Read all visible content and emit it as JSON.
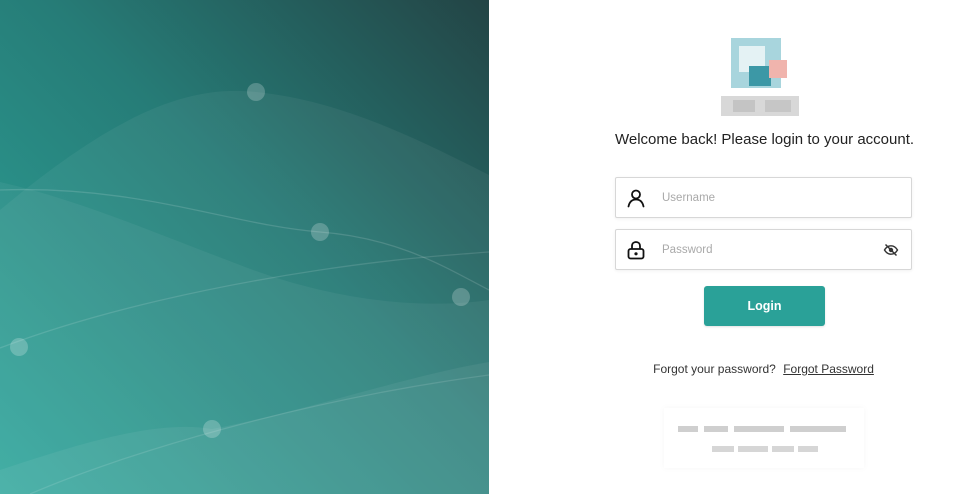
{
  "login": {
    "welcome_text": "Welcome back! Please login to your account.",
    "username_placeholder": "Username",
    "password_placeholder": "Password",
    "login_label": "Login",
    "forgot_prompt": "Forgot your password?",
    "forgot_link": "Forgot Password"
  },
  "icons": {
    "username": "user-icon",
    "password": "lock-icon",
    "toggle": "eye-slash-icon"
  },
  "colors": {
    "accent": "#2aa198",
    "panel_dark": "#244845",
    "panel_light": "#2ea79c"
  }
}
